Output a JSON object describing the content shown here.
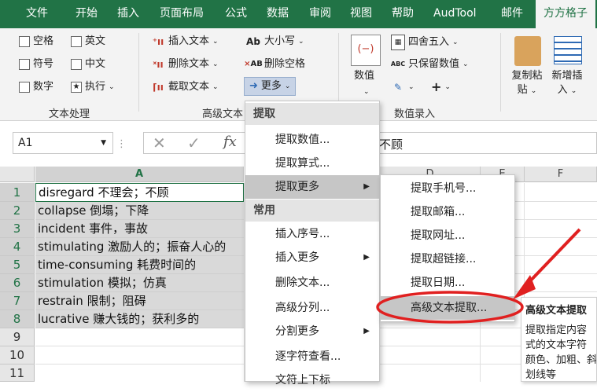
{
  "tabs": [
    "文件",
    "开始",
    "插入",
    "页面布局",
    "公式",
    "数据",
    "审阅",
    "视图",
    "帮助",
    "AudTool",
    "邮件",
    "方方格子"
  ],
  "ribbon": {
    "text_group": {
      "items": [
        "空格",
        "英文",
        "符号",
        "中文",
        "数字",
        "执行"
      ],
      "label": "文本处理"
    },
    "adv_group": {
      "insert": "插入文本",
      "delete": "删除文本",
      "extract": "截取文本",
      "case": "大小写",
      "del_space": "删除空格",
      "more": "更多",
      "label": "高级文本"
    },
    "num_group": {
      "value": "数值",
      "round": "四舍五入",
      "keep": "只保留数值",
      "label": "数值录入"
    },
    "right": {
      "copy_paste_1": "复制粘",
      "copy_paste_2": "贴",
      "new_insert_1": "新增插",
      "new_insert_2": "入"
    }
  },
  "formula_bar": {
    "name_box": "A1",
    "fx": "fx",
    "content": "不顾"
  },
  "sheet": {
    "columns": [
      "A",
      "D",
      "E",
      "F"
    ],
    "rows": [
      "1",
      "2",
      "3",
      "4",
      "5",
      "6",
      "7",
      "8",
      "9",
      "10",
      "11"
    ],
    "cells": [
      "disregard 不理会；不顾",
      "collapse 倒塌；下降",
      "incident 事件，事故",
      "stimulating 激励人的；振奋人心的",
      "time-consuming 耗费时间的",
      "stimulation 模拟；仿真",
      "restrain 限制；阻碍",
      "lucrative 赚大钱的；获利多的"
    ]
  },
  "menu1": {
    "head1": "提取",
    "items1": [
      "提取数值...",
      "提取算式...",
      "提取更多"
    ],
    "head2": "常用",
    "items2": [
      "插入序号...",
      "插入更多",
      "删除文本...",
      "高级分列...",
      "分割更多",
      "逐字符查看...",
      "文符上下标"
    ]
  },
  "menu2": {
    "items": [
      "提取手机号...",
      "提取邮箱...",
      "提取网址...",
      "提取超链接...",
      "提取日期...",
      "高级文本提取..."
    ]
  },
  "tooltip": {
    "title": "高级文本提取",
    "line1": "提取指定内容",
    "line2": "式的文本字符",
    "line3": "颜色、加粗、斜",
    "line4": "划线等"
  },
  "colors": {
    "accent": "#217346",
    "annotation": "#e02020"
  }
}
